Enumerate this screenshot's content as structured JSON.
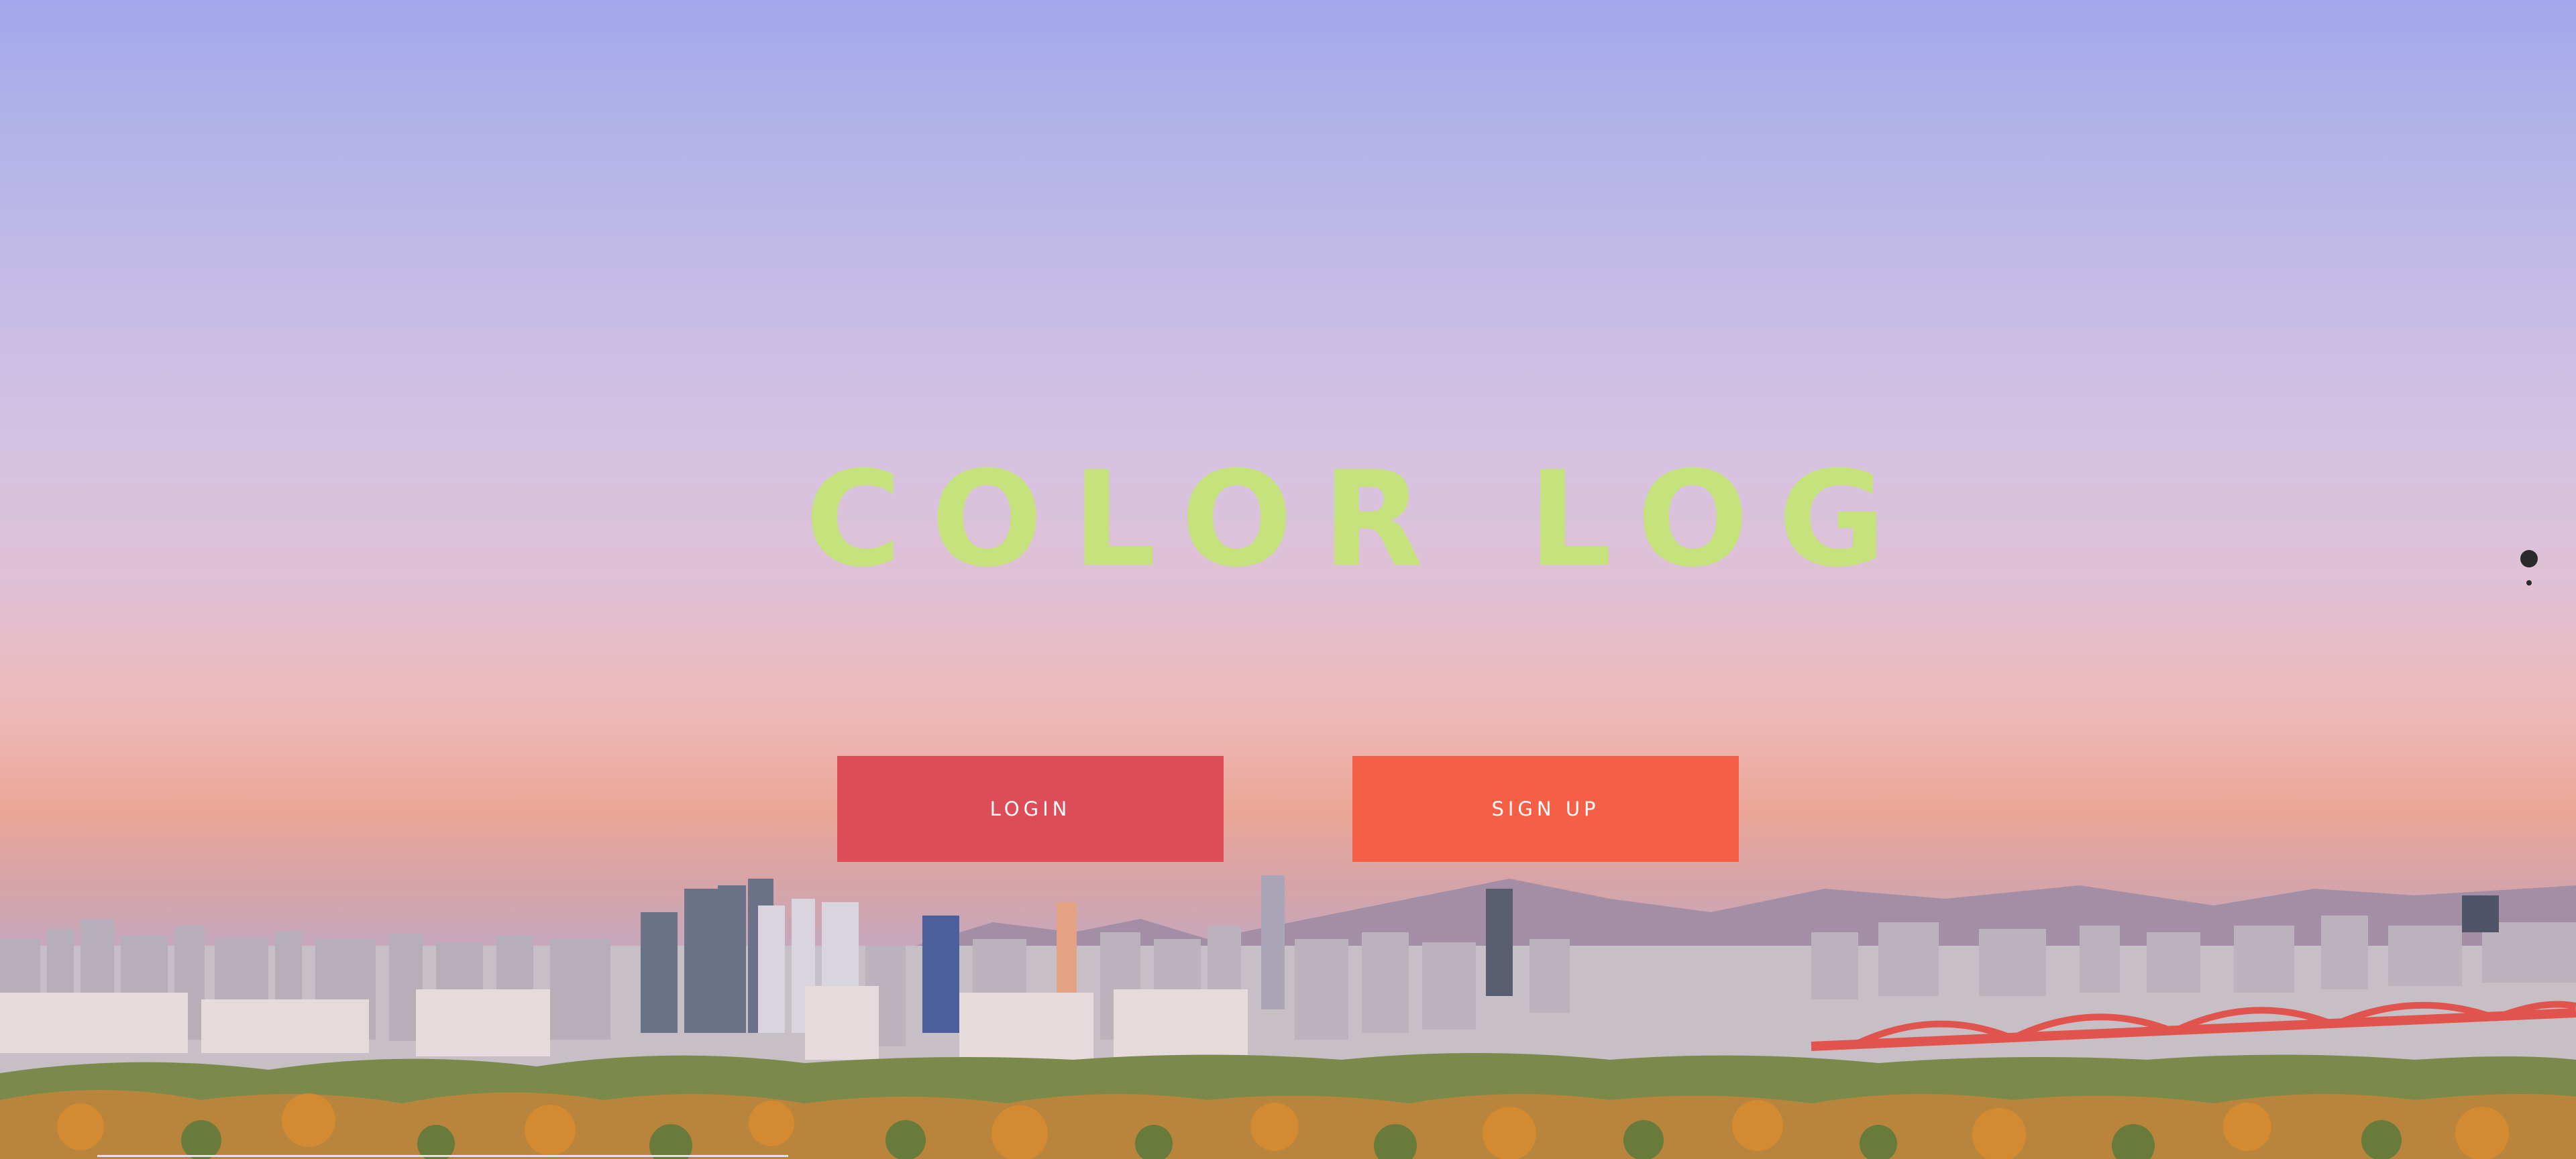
{
  "hero": {
    "title": "COLOR LOG",
    "title_color": "#c6e27d"
  },
  "buttons": {
    "login_label": "LOGIN",
    "login_color": "#dc4d57",
    "signup_label": "SIGN UP",
    "signup_color": "#f55f46"
  },
  "pagination": {
    "active_index": 0,
    "total": 2
  }
}
